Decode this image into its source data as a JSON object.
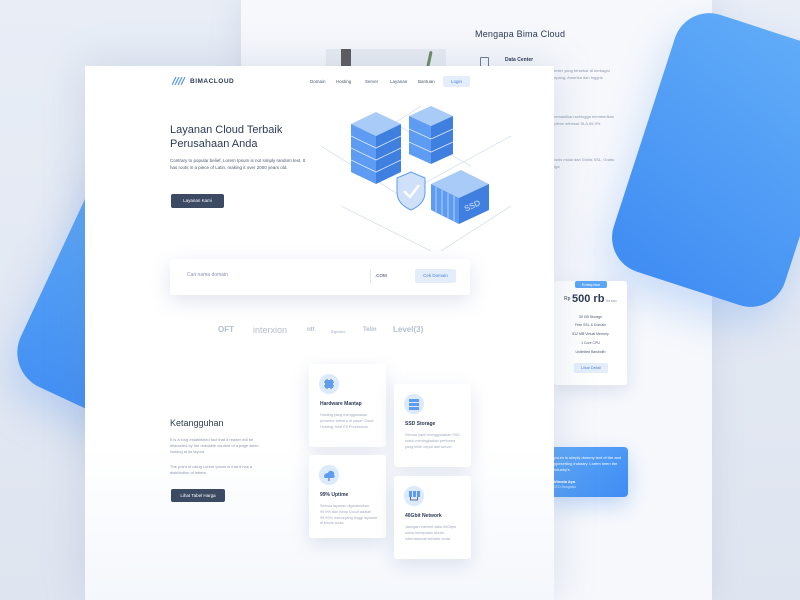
{
  "back": {
    "title": "Mengapa Bima Cloud",
    "data_center": "Data Center",
    "snippets": [
      "center yang tersebar di berbagai",
      "Jepang, Amerika dan Inggris",
      "memastikan sehingga memberikan",
      "uptime sebesar SLA 99,9%",
      "bisnis mulai dari Gratis SSL, Gratis",
      "Tiga"
    ]
  },
  "pricing": {
    "badge": "Enterprise",
    "currency": "Rp",
    "amount": "500 rb",
    "period": "/bulan",
    "features": [
      "30 GB Storage",
      "Free SSL & Domain",
      "512 MB Virtual Memory",
      "1 Core CPU",
      "Unlimited Bandwith"
    ],
    "button": "Lihat Detail"
  },
  "testimonial": {
    "text": "Ipsum is simply dummy text of the and typesetting industry. Lorem been the industry's",
    "name": "Wimala Aya",
    "role": "CEO Bangwbu"
  },
  "header": {
    "brand": "BIMACLOUD",
    "nav": [
      "Domain",
      "Hosting",
      "Server",
      "Layanan",
      "Bantuan"
    ],
    "login": "Login"
  },
  "hero": {
    "title": "Layanan Cloud Terbaik Perusahaan Anda",
    "subtitle": "Contrary to popular belief, Lorem Ipsum is not simply random text. It has roots in a piece of Latin, making it over 2000 years old.",
    "button": "Layanan Kami",
    "ssd_label": "SSD"
  },
  "search": {
    "placeholder": "Cari nama domain",
    "tld": ".COM",
    "button": "Cek Domain"
  },
  "partners": [
    "OFT",
    "interxion",
    "ntt",
    "Equinix",
    "Telin",
    "Level(3)"
  ],
  "ketangguhan": {
    "title": "Ketangguhan",
    "p1": "It is a long established fact that a reader will be distracted by the readable content of a page when looking at its layout.",
    "p2": "The point of using Lorem Ipsum is that it has a distribution of letters.",
    "button": "Lihat Tabel Harga"
  },
  "features": [
    {
      "title": "Hardware Mantap",
      "desc": "Hosting yang menggunakan prosesor terbaru di pasar Cloud Hosting, Intel E5 Processors.",
      "icon": "chip-icon"
    },
    {
      "title": "SSD Storage",
      "desc": "Semua kami menggunakan SSD untuk meningkatkan performa yang lebih cepat dari server.",
      "icon": "storage-icon"
    },
    {
      "title": "99% Uptime",
      "desc": "Semua layanan digaransikan 99,9% dan Bima Cloud adalah 99,99% menunjang tinggi layanan di bisnis anda.",
      "icon": "cloud-uptime-icon"
    },
    {
      "title": "40Gbit Network",
      "desc": "Jaringan internet data 40Gbps untuk kecepatan akses internasional website anda.",
      "icon": "network-icon"
    }
  ],
  "colors": {
    "accent": "#4f8ff5",
    "dark_button": "#3c4a64",
    "light_button": "#e4eefb"
  }
}
